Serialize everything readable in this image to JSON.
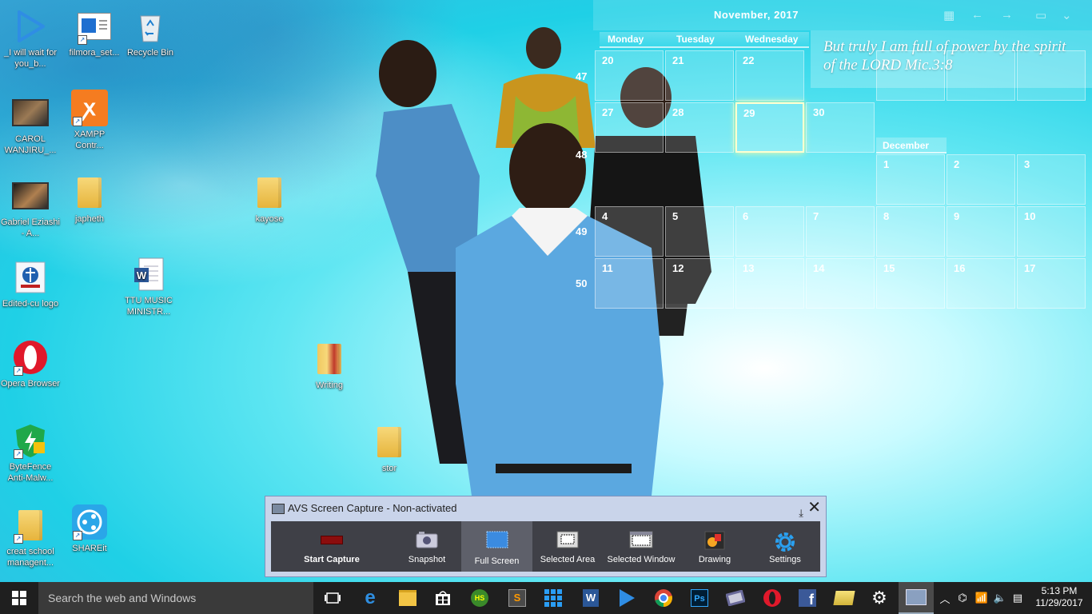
{
  "desktop": {
    "icons": [
      {
        "label": "_I will wait for you_b...",
        "type": "video"
      },
      {
        "label": "filmora_set...",
        "type": "installer"
      },
      {
        "label": "Recycle Bin",
        "type": "recycle"
      },
      {
        "label": "CAROL WANJIRU_...",
        "type": "video"
      },
      {
        "label": "XAMPP Contr...",
        "type": "xampp"
      },
      {
        "label": "Gabriel Eziashi - A...",
        "type": "video"
      },
      {
        "label": "japheth",
        "type": "folder"
      },
      {
        "label": "kayose",
        "type": "folder"
      },
      {
        "label": "Edited-cu logo",
        "type": "image"
      },
      {
        "label": "TTU MUSIC MINISTR...",
        "type": "word"
      },
      {
        "label": "Writing",
        "type": "folder"
      },
      {
        "label": "Opera Browser",
        "type": "opera"
      },
      {
        "label": "ByteFence Anti-Malw...",
        "type": "shield"
      },
      {
        "label": "stor",
        "type": "folder"
      },
      {
        "label": "creat school managent...",
        "type": "folder"
      },
      {
        "label": "SHAREit",
        "type": "shareit"
      }
    ]
  },
  "calendar": {
    "month_title": "November, 2017",
    "day_headers": [
      "Monday",
      "Tuesday",
      "Wednesday"
    ],
    "week_numbers": [
      "47",
      "48",
      "49",
      "50"
    ],
    "november_days": [
      "20",
      "21",
      "22",
      "27",
      "28",
      "29",
      "30"
    ],
    "today": "29",
    "december_label": "December",
    "december_days": [
      "1",
      "2",
      "3",
      "4",
      "5",
      "6",
      "7",
      "8",
      "9",
      "10",
      "11",
      "12",
      "13",
      "14",
      "15",
      "16",
      "17"
    ],
    "verse": "But truly I am full of power by the spirit of the LORD    Mic.3:8"
  },
  "avs": {
    "title": "AVS Screen Capture - Non-activated",
    "tools": [
      {
        "label": "Start Capture",
        "icon": "record-icon"
      },
      {
        "label": "Snapshot",
        "icon": "camera-icon"
      },
      {
        "label": "Full Screen",
        "icon": "fullscreen-icon"
      },
      {
        "label": "Selected Area",
        "icon": "selected-area-icon"
      },
      {
        "label": "Selected Window",
        "icon": "selected-window-icon"
      },
      {
        "label": "Drawing",
        "icon": "drawing-icon"
      },
      {
        "label": "Settings",
        "icon": "settings-icon"
      }
    ],
    "active_tool": "Full Screen"
  },
  "taskbar": {
    "search_placeholder": "Search the web and Windows",
    "apps": [
      "task-view",
      "edge",
      "file-explorer",
      "store",
      "hs",
      "sublime",
      "grid-app",
      "word",
      "media-player",
      "chrome",
      "photoshop",
      "video-editor",
      "opera",
      "facebook",
      "folder-app",
      "settings",
      "avs-screen-capture"
    ],
    "time": "5:13 PM",
    "date": "11/29/2017"
  }
}
